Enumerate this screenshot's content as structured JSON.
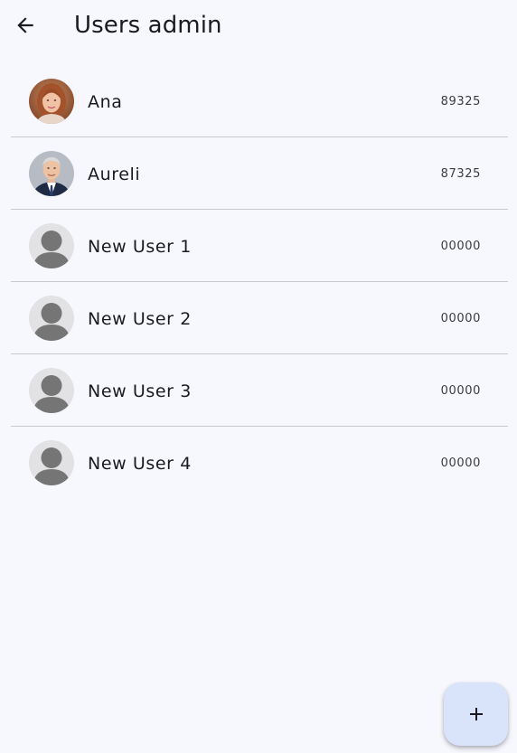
{
  "app": {
    "title": "Users admin"
  },
  "icons": {
    "back": "arrow-left-icon",
    "add": "plus-icon",
    "default_avatar": "person-placeholder-icon"
  },
  "colors": {
    "background": "#f7f8fe",
    "fab_background": "#d9e4fb",
    "divider": "#c9c9cf",
    "placeholder_avatar_bg": "#e2e2e4",
    "placeholder_avatar_fg": "#757575"
  },
  "users": [
    {
      "name": "Ana",
      "code": "89325",
      "avatar": "photo"
    },
    {
      "name": "Aureli",
      "code": "87325",
      "avatar": "photo"
    },
    {
      "name": "New User 1",
      "code": "00000",
      "avatar": "placeholder"
    },
    {
      "name": "New User 2",
      "code": "00000",
      "avatar": "placeholder"
    },
    {
      "name": "New User 3",
      "code": "00000",
      "avatar": "placeholder"
    },
    {
      "name": "New User 4",
      "code": "00000",
      "avatar": "placeholder"
    }
  ]
}
